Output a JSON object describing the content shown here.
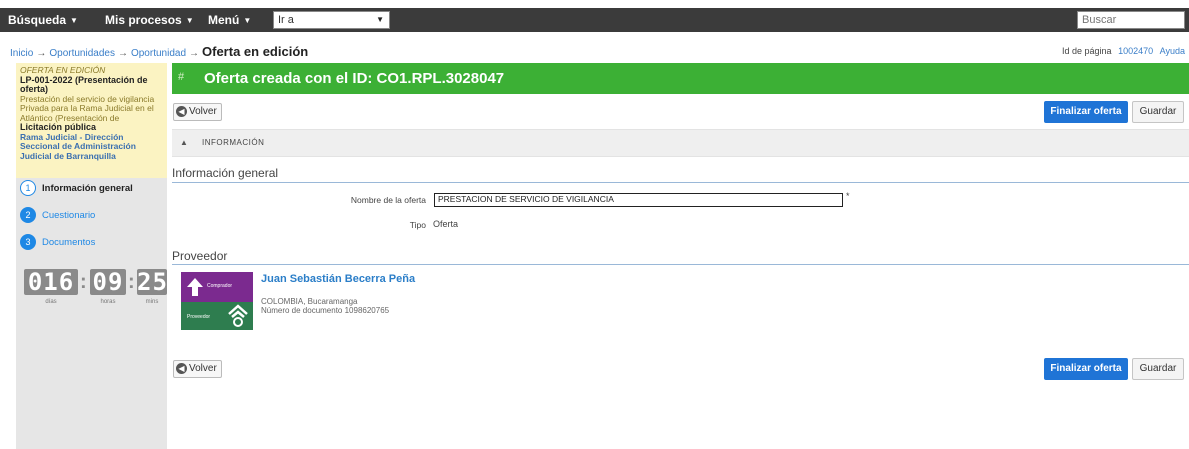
{
  "topbar": {
    "menus": [
      {
        "label": "Búsqueda"
      },
      {
        "label": "Mis procesos"
      },
      {
        "label": "Menú"
      }
    ],
    "goto_value": "Ir a",
    "search_placeholder": "Buscar"
  },
  "breadcrumb": {
    "items": [
      "Inicio",
      "Oportunidades",
      "Oportunidad"
    ],
    "current": "Oferta en edición"
  },
  "help_links": {
    "page_id_label": "Id de página",
    "page_id": "1002470",
    "help": "Ayuda"
  },
  "process": {
    "state": "OFERTA EN EDICIÓN",
    "code": "LP-001-2022 (Presentación de oferta)",
    "description": "Prestación del servicio de vigilancia Privada para la Rama Judicial en el Atlántico (Presentación de",
    "type": "Licitación pública",
    "entity": "Rama Judicial - Dirección Seccional de Administración Judicial de Barranquilla"
  },
  "steps": [
    {
      "number": "1",
      "label": "Información general",
      "state": "active"
    },
    {
      "number": "2",
      "label": "Cuestionario",
      "state": "pending"
    },
    {
      "number": "3",
      "label": "Documentos",
      "state": "pending"
    }
  ],
  "timer": {
    "days": "016",
    "hours": "09",
    "minutes": "25",
    "days_label": "días",
    "hours_label": "horas",
    "minutes_label": "mins"
  },
  "banner": {
    "message": "Oferta creada con el ID: CO1.RPL.3028047"
  },
  "actions": {
    "back": "Volver",
    "finalize": "Finalizar oferta",
    "save": "Guardar"
  },
  "section_info": {
    "title": "INFORMACIÓN"
  },
  "general_info": {
    "title": "Información general",
    "offer_name_label": "Nombre de la oferta",
    "offer_name_value": "PRESTACION DE SERVICIO DE VIGILANCIA",
    "required_mark": "*",
    "type_label": "Tipo",
    "type_value": "Oferta"
  },
  "provider": {
    "title": "Proveedor",
    "name": "Juan Sebastián Becerra Peña",
    "location": "COLOMBIA, Bucaramanga",
    "document": "Número de documento 1098620765",
    "logo_top_text": "Comprador",
    "logo_bottom_text": "Proveedor"
  },
  "colors": {
    "banner_green": "#3cb035",
    "primary_blue": "#1f74d6",
    "topbar": "#3b3b3b",
    "process_info_bg": "#fbf3c2"
  }
}
